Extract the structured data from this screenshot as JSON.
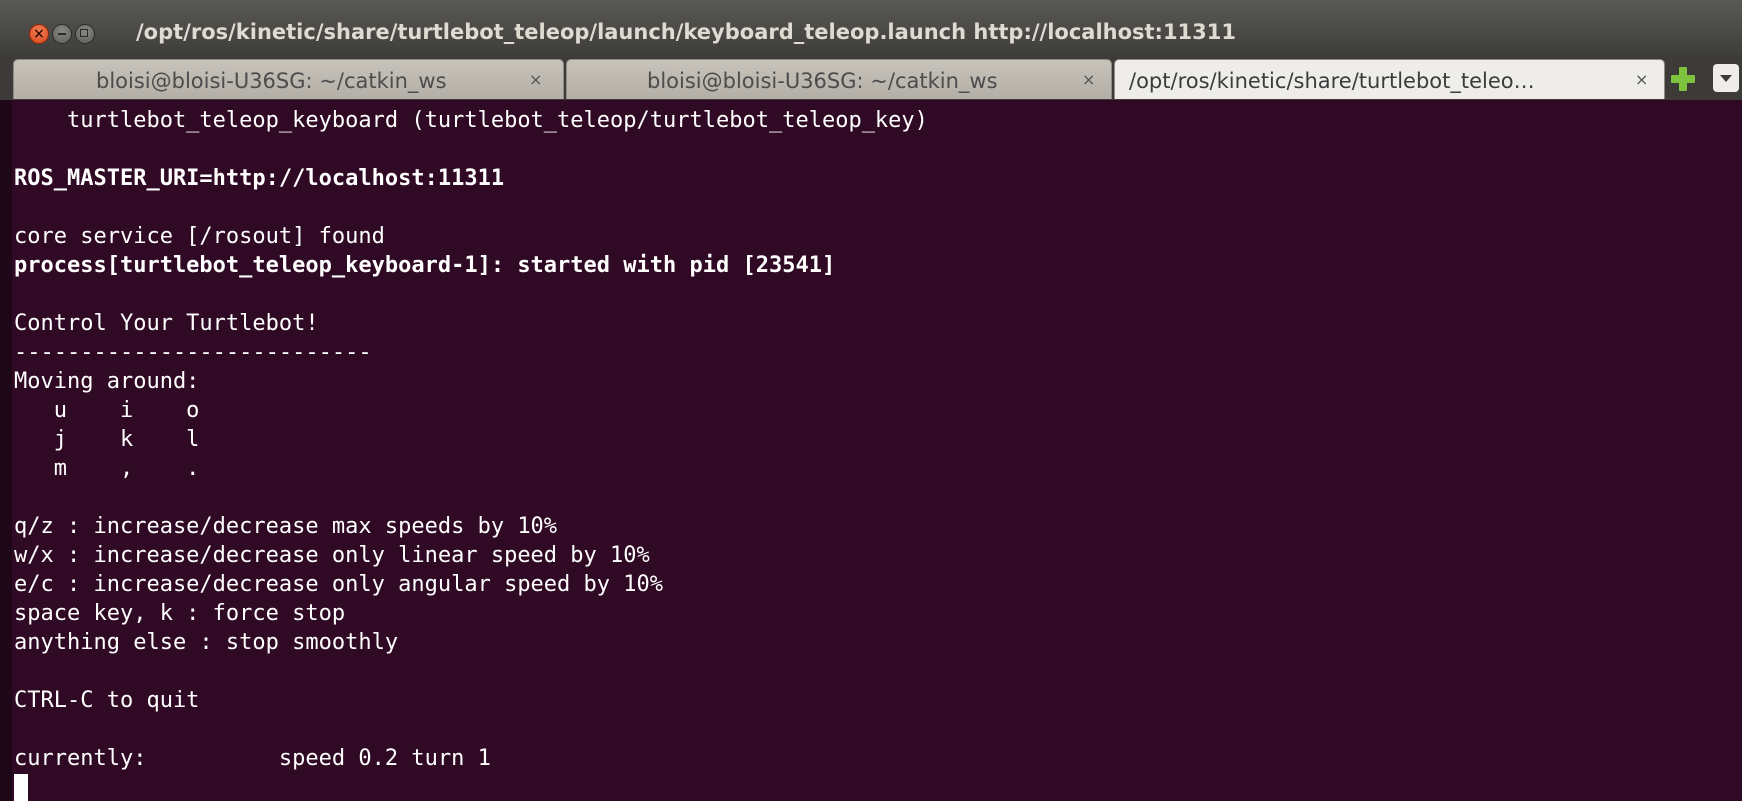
{
  "window": {
    "title": "/opt/ros/kinetic/share/turtlebot_teleop/launch/keyboard_teleop.launch http://localhost:11311",
    "close_glyph": "×"
  },
  "tabs": [
    {
      "label": "bloisi@bloisi-U36SG: ~/catkin_ws",
      "close": "×",
      "active": false
    },
    {
      "label": "bloisi@bloisi-U36SG: ~/catkin_ws",
      "close": "×",
      "active": false
    },
    {
      "label": "/opt/ros/kinetic/share/turtlebot_teleo…",
      "close": "×",
      "active": true
    }
  ],
  "icons": {
    "new_tab": "plus-icon",
    "tab_menu": "chevron-down-icon"
  },
  "colors": {
    "terminal_background": "#300a24",
    "terminal_text": "#ffffff",
    "new_tab_accent": "#7ec23e",
    "close_button": "#e0562a"
  },
  "terminal": {
    "lines": [
      {
        "text": "    turtlebot_teleop_keyboard (turtlebot_teleop/turtlebot_teleop_key)",
        "bold": false
      },
      {
        "text": "",
        "bold": false
      },
      {
        "text": "ROS_MASTER_URI=http://localhost:11311",
        "bold": true
      },
      {
        "text": "",
        "bold": false
      },
      {
        "text": "core service [/rosout] found",
        "bold": false
      },
      {
        "text": "process[turtlebot_teleop_keyboard-1]: started with pid [23541]",
        "bold": true
      },
      {
        "text": "",
        "bold": false
      },
      {
        "text": "Control Your Turtlebot!",
        "bold": false
      },
      {
        "text": "---------------------------",
        "bold": false
      },
      {
        "text": "Moving around:",
        "bold": false
      },
      {
        "text": "   u    i    o",
        "bold": false
      },
      {
        "text": "   j    k    l",
        "bold": false
      },
      {
        "text": "   m    ,    .",
        "bold": false
      },
      {
        "text": "",
        "bold": false
      },
      {
        "text": "q/z : increase/decrease max speeds by 10%",
        "bold": false
      },
      {
        "text": "w/x : increase/decrease only linear speed by 10%",
        "bold": false
      },
      {
        "text": "e/c : increase/decrease only angular speed by 10%",
        "bold": false
      },
      {
        "text": "space key, k : force stop",
        "bold": false
      },
      {
        "text": "anything else : stop smoothly",
        "bold": false
      },
      {
        "text": "",
        "bold": false
      },
      {
        "text": "CTRL-C to quit",
        "bold": false
      },
      {
        "text": "",
        "bold": false
      },
      {
        "text": "currently:\tspeed 0.2\tturn 1",
        "bold": false
      }
    ]
  }
}
